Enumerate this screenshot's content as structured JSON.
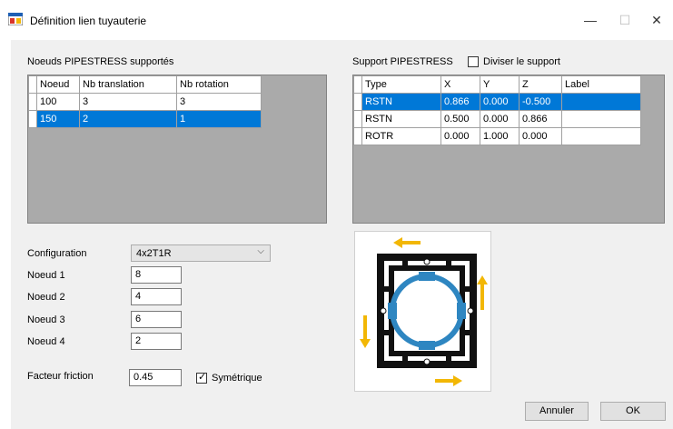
{
  "window": {
    "title": "Définition lien tuyauterie",
    "minimize": "—",
    "maximize": "☐",
    "close": "✕"
  },
  "nodes": {
    "label": "Noeuds PIPESTRESS supportés",
    "columns": [
      "Noeud",
      "Nb translation",
      "Nb rotation"
    ],
    "rows": [
      [
        "100",
        "3",
        "3"
      ],
      [
        "150",
        "2",
        "1"
      ]
    ],
    "selected_row": 1
  },
  "support": {
    "label": "Support PIPESTRESS",
    "divide_label": "Diviser le support",
    "divide_checked": false,
    "columns": [
      "Type",
      "X",
      "Y",
      "Z",
      "Label"
    ],
    "rows": [
      [
        "RSTN",
        "0.866",
        "0.000",
        "-0.500",
        ""
      ],
      [
        "RSTN",
        "0.500",
        "0.000",
        "0.866",
        ""
      ],
      [
        "ROTR",
        "0.000",
        "1.000",
        "0.000",
        ""
      ]
    ],
    "selected_row": 0
  },
  "form": {
    "config_label": "Configuration",
    "config_value": "4x2T1R",
    "noeud1_label": "Noeud 1",
    "noeud1_value": "8",
    "noeud2_label": "Noeud 2",
    "noeud2_value": "4",
    "noeud3_label": "Noeud 3",
    "noeud3_value": "6",
    "noeud4_label": "Noeud 4",
    "noeud4_value": "2",
    "friction_label": "Facteur friction",
    "friction_value": "0.45",
    "sym_label": "Symétrique",
    "sym_checked": true
  },
  "buttons": {
    "cancel": "Annuler",
    "ok": "OK"
  },
  "colors": {
    "selection": "#0078d7",
    "pipe": "#2e86c1",
    "arrow": "#f2b705",
    "frame": "#111111"
  }
}
